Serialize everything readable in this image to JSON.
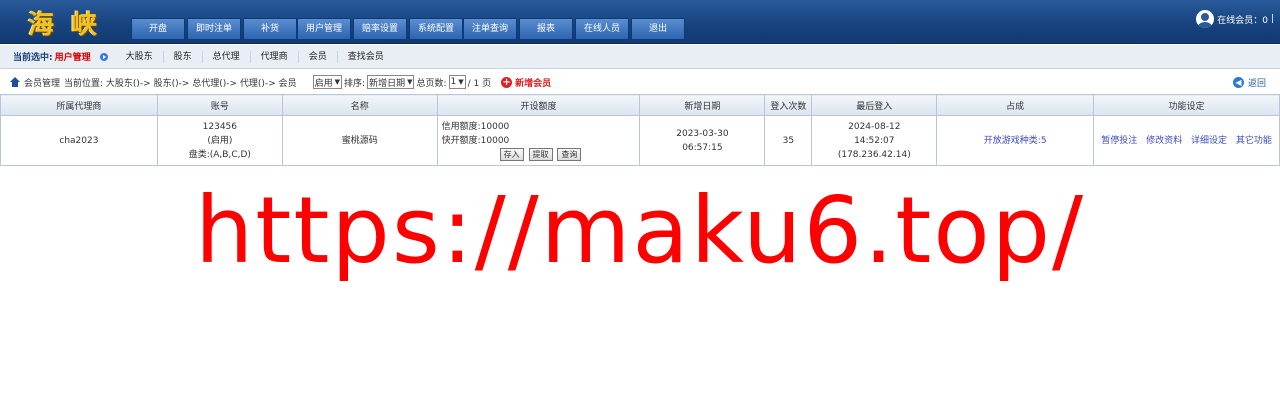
{
  "header": {
    "logo": "海 峡",
    "nav": [
      "开盘",
      "即时注单",
      "补货",
      "用户管理",
      "赔率设置",
      "系统配置",
      "注单查询",
      "报表",
      "在线人员",
      "退出"
    ],
    "online_label": "在线会员：0",
    "online_extra": "|"
  },
  "subnav": {
    "current_label": "当前选中:",
    "current_value": "用户管理",
    "items": [
      "大股东",
      "股东",
      "总代理",
      "代理商",
      "会员",
      "查找会员"
    ]
  },
  "toolbar": {
    "title": "会员管理",
    "location": "当前位置: 大股东()-> 股东()-> 总代理()-> 代理()-> 会员",
    "status_select": "启用",
    "sort_label": "排序:",
    "sort_select": "新增日期",
    "pages_label": "总页数:",
    "page_select": "1",
    "pages_total": "/ 1 页",
    "add_member": "新增会员",
    "back": "返回"
  },
  "table": {
    "headers": [
      "所属代理商",
      "账号",
      "名称",
      "开设额度",
      "新增日期",
      "登入次数",
      "最后登入",
      "占成",
      "功能设定"
    ],
    "rows": [
      {
        "agent": "cha2023",
        "account_id": "123456",
        "account_status": "(启用)",
        "account_category": "盘类:(A,B,C,D)",
        "name": "蜜桃源码",
        "credit_line": "信用额度:10000",
        "quick_line": "快开额度:10000",
        "btn_deposit": "存入",
        "btn_withdraw": "提取",
        "btn_query": "查询",
        "added_date": "2023-03-30",
        "added_time": "06:57:15",
        "login_count": "35",
        "last_login_date": "2024-08-12",
        "last_login_time": "14:52:07",
        "last_login_ip": "(178.236.42.14)",
        "share": "开放游戏种类:5",
        "actions": [
          "暂停投注",
          "修改资料",
          "详细设定",
          "其它功能"
        ]
      }
    ]
  },
  "watermark": "https://maku6.top/"
}
